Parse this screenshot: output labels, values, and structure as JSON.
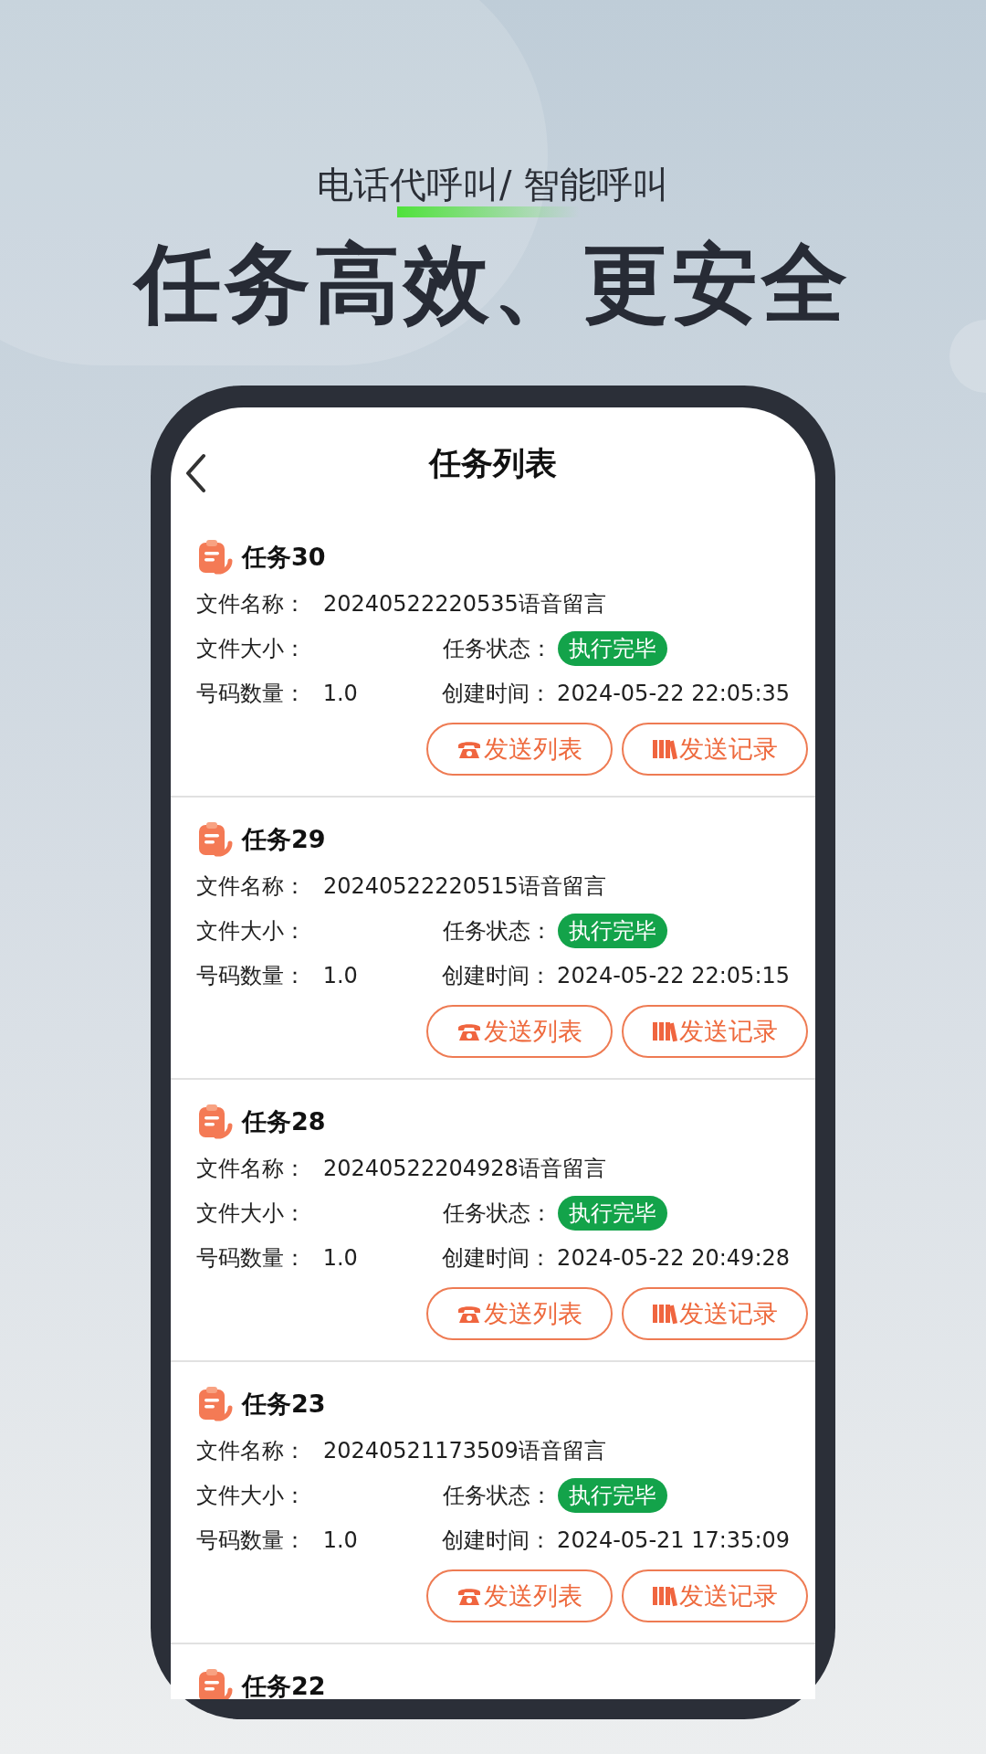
{
  "promo": {
    "subtitle": "电话代呼叫/ 智能呼叫",
    "headline": "任务高效、更安全"
  },
  "screen": {
    "title": "任务列表"
  },
  "tasks": [
    {
      "name": "任务30",
      "file_name_label": "文件名称：",
      "file_name": "20240522220535语音留言",
      "file_size_label": "文件大小：",
      "status_label": "任务状态：",
      "status": "执行完毕",
      "count_label": "号码数量：",
      "count": "1.0",
      "created_label": "创建时间：",
      "created": "2024-05-22 22:05:35",
      "buttons": [
        "发送列表",
        "发送记录"
      ]
    },
    {
      "name": "任务29",
      "file_name_label": "文件名称：",
      "file_name": "20240522220515语音留言",
      "file_size_label": "文件大小：",
      "status_label": "任务状态：",
      "status": "执行完毕",
      "count_label": "号码数量：",
      "count": "1.0",
      "created_label": "创建时间：",
      "created": "2024-05-22 22:05:15",
      "buttons": [
        "发送列表",
        "发送记录"
      ]
    },
    {
      "name": "任务28",
      "file_name_label": "文件名称：",
      "file_name": "20240522204928语音留言",
      "file_size_label": "文件大小：",
      "status_label": "任务状态：",
      "status": "执行完毕",
      "count_label": "号码数量：",
      "count": "1.0",
      "created_label": "创建时间：",
      "created": "2024-05-22 20:49:28",
      "buttons": [
        "发送列表",
        "发送记录"
      ]
    },
    {
      "name": "任务23",
      "file_name_label": "文件名称：",
      "file_name": "20240521173509语音留言",
      "file_size_label": "文件大小：",
      "status_label": "任务状态：",
      "status": "执行完毕",
      "count_label": "号码数量：",
      "count": "1.0",
      "created_label": "创建时间：",
      "created": "2024-05-21 17:35:09",
      "buttons": [
        "发送列表",
        "发送记录"
      ]
    },
    {
      "name": "任务22"
    }
  ]
}
